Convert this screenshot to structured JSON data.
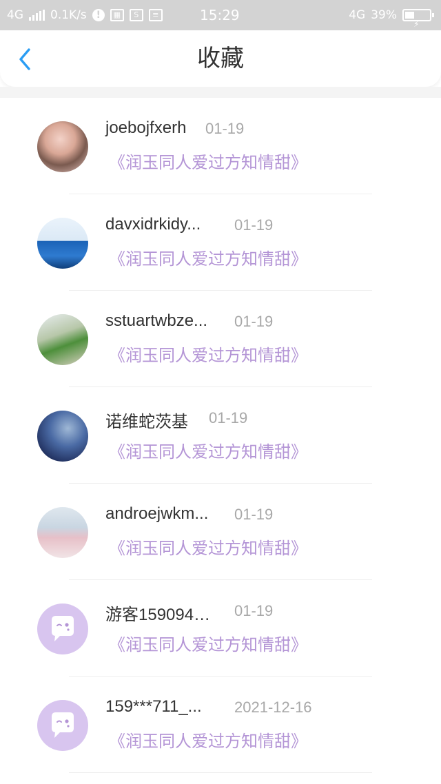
{
  "status_bar": {
    "network": "4G",
    "speed": "0.1K/s",
    "time": "15:29",
    "network_right": "4G",
    "battery": "39%"
  },
  "header": {
    "title": "收藏",
    "back_icon": "chevron-left-icon",
    "accent_color": "#2a9df4"
  },
  "favorites": [
    {
      "name": "joebojfxerh",
      "date": "01-19",
      "book": "《润玉同人爱过方知情甜》"
    },
    {
      "name": "davxidrkidy...",
      "date": "01-19",
      "book": "《润玉同人爱过方知情甜》"
    },
    {
      "name": "sstuartwbze...",
      "date": "01-19",
      "book": "《润玉同人爱过方知情甜》"
    },
    {
      "name": "诺维蛇茨基",
      "date": "01-19",
      "book": "《润玉同人爱过方知情甜》"
    },
    {
      "name": "androejwkm...",
      "date": "01-19",
      "book": "《润玉同人爱过方知情甜》"
    },
    {
      "name": "游客159094…",
      "date": "01-19",
      "book": "《润玉同人爱过方知情甜》"
    },
    {
      "name": "159***711_...",
      "date": "2021-12-16",
      "book": "《润玉同人爱过方知情甜》"
    }
  ],
  "colors": {
    "book_title": "#b495d6",
    "default_avatar": "#d8c5ef",
    "status_bar": "#d3d3d3"
  }
}
